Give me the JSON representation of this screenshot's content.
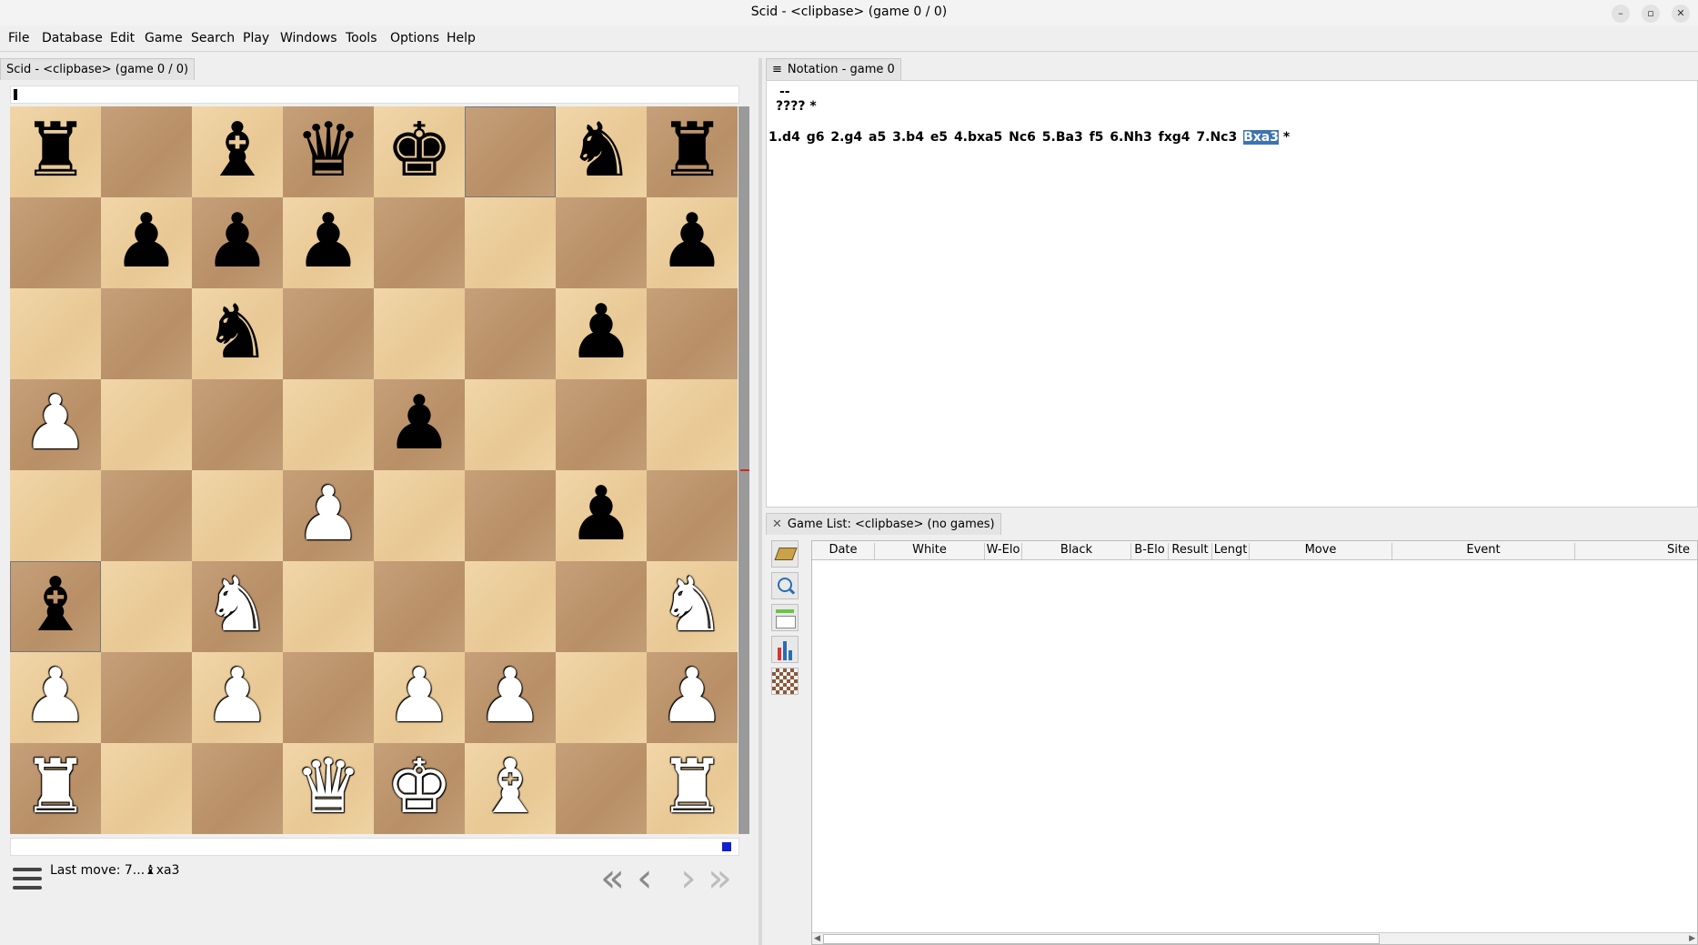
{
  "window": {
    "title": "Scid - <clipbase> (game 0 / 0)"
  },
  "menu": [
    "File",
    "Database",
    "Edit",
    "Game",
    "Search",
    "Play",
    "Windows",
    "Tools",
    "Options",
    "Help"
  ],
  "board_panel": {
    "tab_label": "Scid - <clipbase> (game 0 / 0)",
    "last_move": "Last move: 7...♝xa3",
    "ranks": [
      "r . b q k . n r",
      ". p p p . . . p",
      ". . n . . . p .",
      "P . . . p . . .",
      ". . . P . . p .",
      "b . N . . . . N",
      "P . P . P P . P",
      "R . . Q K B . R"
    ]
  },
  "notation": {
    "tab_label": "Notation - game 0",
    "header_line1": "--",
    "header_line2": "????  *",
    "moves": [
      "1.d4",
      "g6",
      "2.g4",
      "a5",
      "3.b4",
      "e5",
      "4.bxa5",
      "Nc6",
      "5.Ba3",
      "f5",
      "6.Nh3",
      "fxg4",
      "7.Nc3"
    ],
    "current_move": "Bxa3",
    "result": "*"
  },
  "game_list": {
    "tab_label": "Game List: <clipbase> (no games)",
    "columns": [
      "Date",
      "White",
      "W-Elo",
      "Black",
      "B-Elo",
      "Result",
      "Lengt",
      "Move",
      "Event",
      "Site"
    ]
  }
}
